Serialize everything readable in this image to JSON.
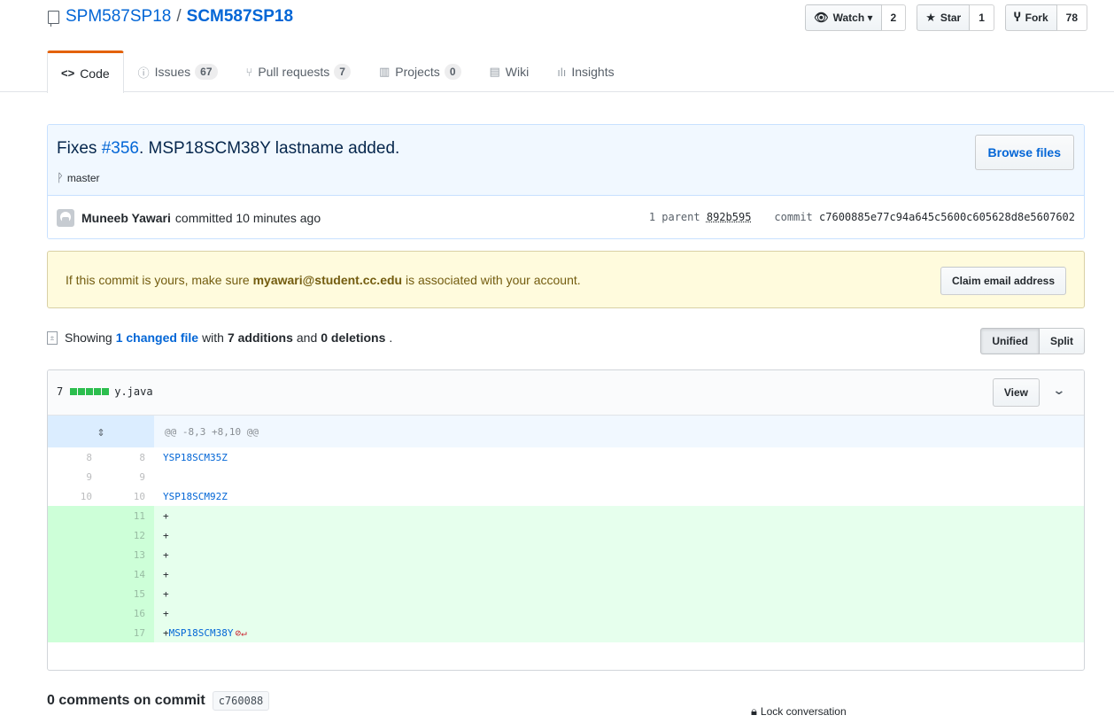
{
  "repo": {
    "owner": "SPM587SP18",
    "separator": "/",
    "name": "SCM587SP18"
  },
  "actions": {
    "watch_label": "Watch ▾",
    "watch_count": "2",
    "star_label": "Star",
    "star_count": "1",
    "fork_label": "Fork",
    "fork_count": "78"
  },
  "nav": {
    "code": "Code",
    "issues": "Issues",
    "issues_count": "67",
    "pulls": "Pull requests",
    "pulls_count": "7",
    "projects": "Projects",
    "projects_count": "0",
    "wiki": "Wiki",
    "insights": "Insights"
  },
  "commit": {
    "title_prefix": "Fixes ",
    "issue_link": "#356",
    "title_suffix": ". MSP18SCM38Y lastname added.",
    "branch": "master",
    "browse_label": "Browse files",
    "author": "Muneeb Yawari",
    "time": "committed 10 minutes ago",
    "parent_label": "1 parent",
    "parent_sha": "892b595",
    "commit_label": "commit",
    "full_sha": "c7600885e77c94a645c5600c605628d8e5607602"
  },
  "flash": {
    "prefix": "If this commit is yours, make sure",
    "email": "myawari@student.cc.edu",
    "suffix": "is associated with your account.",
    "claim_label": "Claim email address"
  },
  "toc": {
    "showing": "Showing",
    "changed": "1 changed file",
    "with": "with",
    "additions": "7 additions",
    "and": "and",
    "deletions": "0 deletions",
    "period": ".",
    "unified": "Unified",
    "split": "Split"
  },
  "file": {
    "diffstat": "7",
    "name": "y.java",
    "view_label": "View",
    "hunk": "@@ -8,3 +8,10 @@",
    "context_lines": [
      {
        "old": "8",
        "new": "8",
        "text": "YSP18SCM35Z"
      },
      {
        "old": "9",
        "new": "9",
        "text": ""
      },
      {
        "old": "10",
        "new": "10",
        "text": "YSP18SCM92Z"
      }
    ],
    "added_lines": [
      {
        "new": "11",
        "text": "+"
      },
      {
        "new": "12",
        "text": "+"
      },
      {
        "new": "13",
        "text": "+"
      },
      {
        "new": "14",
        "text": "+"
      },
      {
        "new": "15",
        "text": "+"
      },
      {
        "new": "16",
        "text": "+"
      },
      {
        "new": "17",
        "text": "+",
        "code": "MSP18SCM38Y"
      }
    ]
  },
  "comments": {
    "label": "0 comments on commit",
    "sha": "c760088",
    "lock": "Lock conversation"
  },
  "colors": {
    "link": "#0366d6",
    "addition": "#2cbe4e",
    "active_tab": "#e36209"
  }
}
